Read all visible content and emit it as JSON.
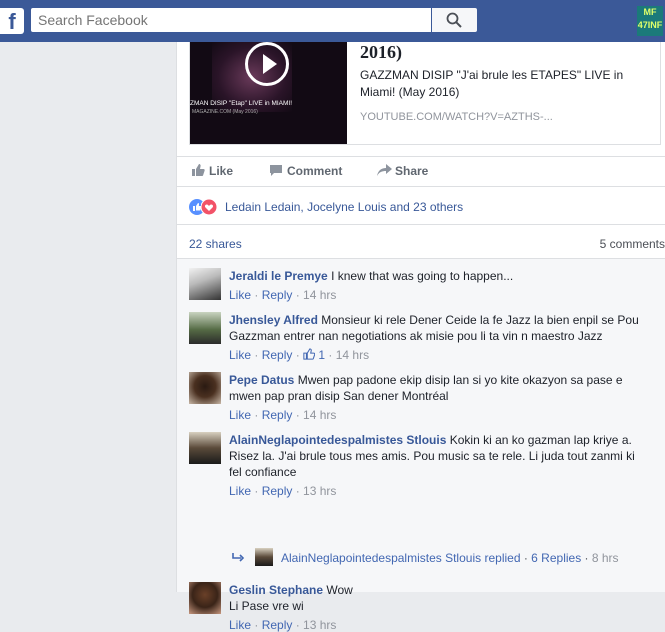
{
  "topbar": {
    "logo": "f",
    "search_placeholder": "Search Facebook",
    "user_badge_line1": "MF",
    "user_badge_line2": "47INF"
  },
  "link_preview": {
    "title": "2016)",
    "thumb_caption": "ZMAN DISIP \"Etap\" LIVE in MIAMI!",
    "thumb_subcaption": "MAGAZINE.COM (May 2016)",
    "description": "GAZZMAN DISIP \"J'ai brule les ETAPES\" LIVE in Miami! (May 2016)",
    "url": "YOUTUBE.COM/WATCH?V=AZTHS-..."
  },
  "actions": {
    "like": "Like",
    "comment": "Comment",
    "share": "Share"
  },
  "reactions_text": "Ledain Ledain, Jocelyne Louis and 23 others",
  "shares": "22 shares",
  "comments_count": "5 comments",
  "comments": [
    {
      "name": "Jeraldi le Premye",
      "text": "I knew that was going to happen...",
      "like": "Like",
      "reply": "Reply",
      "time": "14 hrs",
      "likes": ""
    },
    {
      "name": "Jhensley Alfred",
      "text": "Monsieur ki rele Dener Ceide la fe Jazz la bien enpil se Pou Gazzman entrer nan negotiations ak misie pou li ta vin n maestro Jazz",
      "like": "Like",
      "reply": "Reply",
      "time": "14 hrs",
      "likes": "1"
    },
    {
      "name": "Pepe Datus",
      "text": "Mwen pap padone ekip disip lan si yo kite okazyon sa pase e mwen pap pran disip San dener Montréal",
      "like": "Like",
      "reply": "Reply",
      "time": "14 hrs",
      "likes": ""
    },
    {
      "name": "AlainNeglapointedespalmistes Stlouis",
      "text": "Kokin ki an ko gazman lap kriye a. Risez la. J'ai brule tous mes amis. Pou music sa te rele. Li juda tout zanmi ki fel confiance",
      "like": "Like",
      "reply": "Reply",
      "time": "13 hrs",
      "likes": ""
    },
    {
      "name": "Geslin Stephane",
      "text": "Wow\nLi Pase vre wi",
      "like": "Like",
      "reply": "Reply",
      "time": "13 hrs",
      "likes": ""
    }
  ],
  "reply_thread": {
    "name": "AlainNeglapointedespalmistes Stlouis",
    "action": "replied",
    "count": "6 Replies",
    "time": "8 hrs"
  }
}
